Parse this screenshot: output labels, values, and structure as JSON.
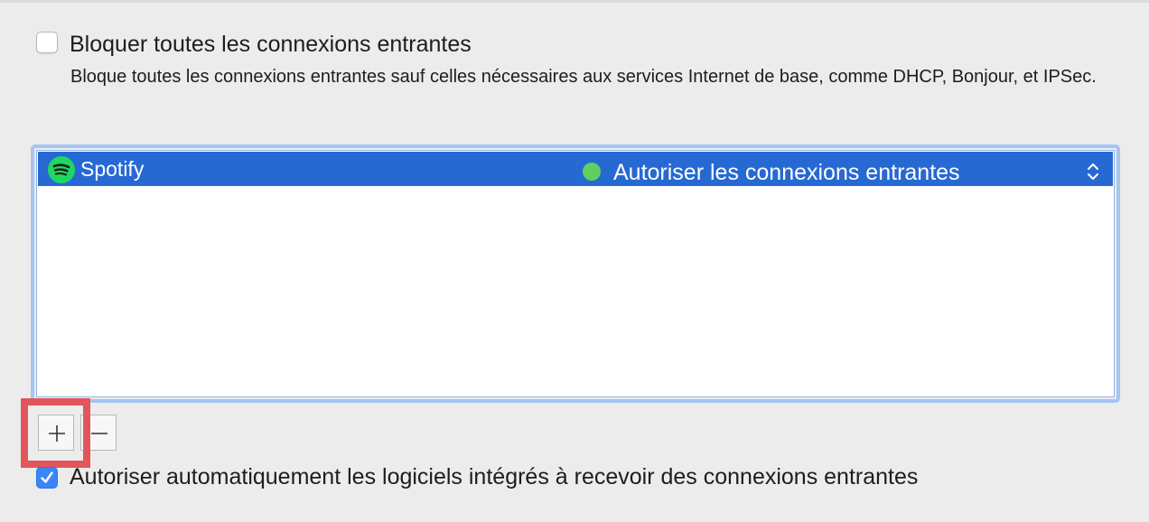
{
  "block_all": {
    "label": "Bloquer toutes les connexions entrantes",
    "description": "Bloque toutes les connexions entrantes sauf celles nécessaires aux services Internet de base, comme DHCP, Bonjour, et IPSec.",
    "checked": false
  },
  "app_list": {
    "rows": [
      {
        "name": "Spotify",
        "icon": "spotify-icon",
        "status_color": "#5fd05f",
        "status": "Autoriser les connexions entrantes",
        "selected": true
      }
    ]
  },
  "buttons": {
    "add_label": "+",
    "remove_label": "−"
  },
  "auto_allow": {
    "label": "Autoriser automatiquement les logiciels intégrés à recevoir des connexions entrantes",
    "checked": true
  },
  "colors": {
    "selection": "#2769d3",
    "accent": "#3b86f7",
    "highlight": "#e0565b",
    "background": "#ececec"
  }
}
